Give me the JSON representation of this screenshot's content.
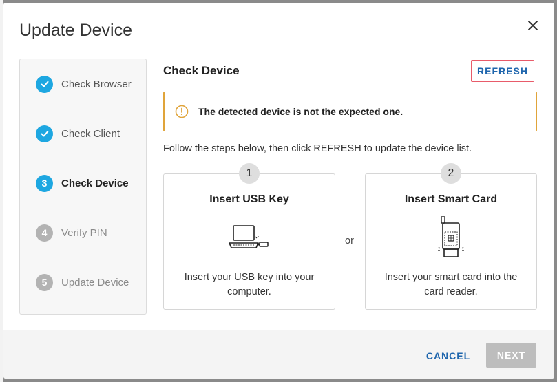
{
  "dialog": {
    "title": "Update Device"
  },
  "stepper": {
    "steps": [
      {
        "label": "Check Browser",
        "number": "1",
        "state": "done"
      },
      {
        "label": "Check Client",
        "number": "2",
        "state": "done"
      },
      {
        "label": "Check Device",
        "number": "3",
        "state": "active"
      },
      {
        "label": "Verify PIN",
        "number": "4",
        "state": "pending"
      },
      {
        "label": "Update Device",
        "number": "5",
        "state": "pending"
      }
    ]
  },
  "main": {
    "heading": "Check Device",
    "refresh_label": "REFRESH",
    "alert": {
      "text": "The detected device is not the expected one.",
      "icon": "warning-circle-icon",
      "color": "#e0a43a"
    },
    "instructions": "Follow the steps below, then click REFRESH to update the device list.",
    "separator": "or",
    "cards": [
      {
        "number": "1",
        "title": "Insert USB Key",
        "description": "Insert your USB key into your computer.",
        "icon": "laptop-usb-icon"
      },
      {
        "number": "2",
        "title": "Insert Smart Card",
        "description": "Insert your smart card into the card reader.",
        "icon": "smart-card-reader-icon"
      }
    ]
  },
  "footer": {
    "cancel_label": "CANCEL",
    "next_label": "NEXT"
  },
  "colors": {
    "accent": "#1ea7e1",
    "link": "#1f66ad",
    "refresh_border": "#e85b6a",
    "disabled": "#bdbdbd"
  }
}
